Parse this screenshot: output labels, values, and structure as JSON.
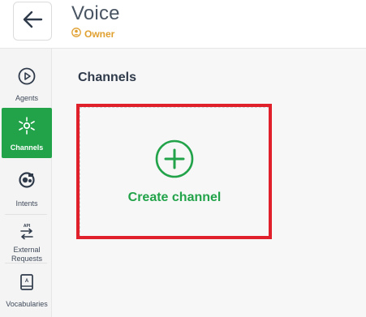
{
  "header": {
    "title": "Voice",
    "role": "Owner",
    "back_icon": "arrow-left-icon",
    "role_icon": "user-circle-icon"
  },
  "sidebar": {
    "items": [
      {
        "label": "Agents",
        "icon": "play-circle-icon",
        "active": false
      },
      {
        "label": "Channels",
        "icon": "hub-icon",
        "active": true
      },
      {
        "label": "Intents",
        "icon": "intents-icon",
        "active": false
      },
      {
        "label": "External Requests",
        "icon": "api-arrows-icon",
        "active": false
      },
      {
        "label": "Vocabularies",
        "icon": "book-icon",
        "active": false
      }
    ]
  },
  "main": {
    "section_title": "Channels",
    "create_card": {
      "label": "Create channel",
      "icon": "plus-circle-icon"
    }
  },
  "colors": {
    "accent_green": "#22a34a",
    "role_orange": "#e0a030",
    "highlight_red": "#e0202a"
  }
}
